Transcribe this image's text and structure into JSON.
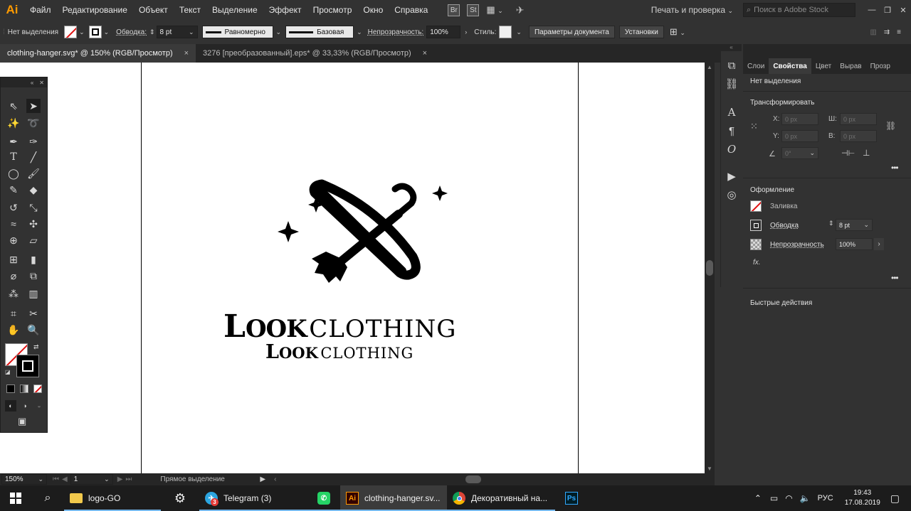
{
  "app": {
    "logo": "Ai",
    "menu": [
      "Файл",
      "Редактирование",
      "Объект",
      "Текст",
      "Выделение",
      "Эффект",
      "Просмотр",
      "Окно",
      "Справка"
    ],
    "bridge_badge": "Br",
    "stock_badge": "St",
    "workspace_label": "Печать и проверка",
    "stock_search_placeholder": "Поиск в Adobe Stock"
  },
  "control_bar": {
    "selection_label": "Нет выделения",
    "stroke_label": "Обводка:",
    "stroke_weight": "8 pt",
    "profile_label": "Равномерно",
    "brush_label": "Базовая",
    "opacity_label": "Непрозрачность:",
    "opacity_value": "100%",
    "style_label": "Стиль:",
    "doc_setup_button": "Параметры документа",
    "prefs_button": "Установки"
  },
  "tabs": [
    {
      "label": "clothing-hanger.svg* @ 150% (RGB/Просмотр)",
      "close": "×"
    },
    {
      "label": "3276 [преобразованный].eps* @ 33,33% (RGB/Просмотр)",
      "close": "×"
    }
  ],
  "artwork": {
    "line1_big": "L",
    "line1_small": "OOK",
    "line1_rest": "CLOTHING",
    "line2_big": "L",
    "line2_small": "OOK",
    "line2_rest": "CLOTHING"
  },
  "status_bar": {
    "zoom": "150%",
    "artboard": "1",
    "tool_status": "Прямое выделение"
  },
  "panel": {
    "tabs": [
      "Слои",
      "Свойства",
      "Цвет",
      "Вырав",
      "Прозр"
    ],
    "active_tab": "Свойства",
    "no_selection": "Нет выделения",
    "transform_title": "Трансформировать",
    "x_label": "X:",
    "y_label": "Y:",
    "w_label": "Ш:",
    "h_label": "В:",
    "x_value": "0 px",
    "y_value": "0 px",
    "w_value": "0 px",
    "h_value": "0 px",
    "angle_value": "0°",
    "appearance_title": "Оформление",
    "fill_label": "Заливка",
    "stroke_label": "Обводка",
    "stroke_value": "8 pt",
    "opacity_label": "Непрозрачность",
    "opacity_value": "100%",
    "fx_label": "fx.",
    "quick_actions_title": "Быстрые действия"
  },
  "taskbar": {
    "apps": [
      {
        "label": "logo-GO",
        "icon": "folder-icon"
      },
      {
        "label": "",
        "icon": "gear-icon"
      },
      {
        "label": "Telegram (3)",
        "icon": "telegram-icon",
        "badge": "3"
      },
      {
        "label": "",
        "icon": "whatsapp-icon"
      },
      {
        "label": "clothing-hanger.sv...",
        "icon": "illustrator-icon"
      },
      {
        "label": "Декоративный на...",
        "icon": "chrome-icon"
      },
      {
        "label": "",
        "icon": "photoshop-icon"
      }
    ],
    "lang": "РУС",
    "time": "19:43",
    "date": "17.08.2019"
  },
  "colors": {
    "illustrator_orange": "#ff9a00",
    "ui_dark": "#323232",
    "ui_darker": "#262626",
    "artboard": "#ffffff",
    "artwork": "#000000"
  }
}
